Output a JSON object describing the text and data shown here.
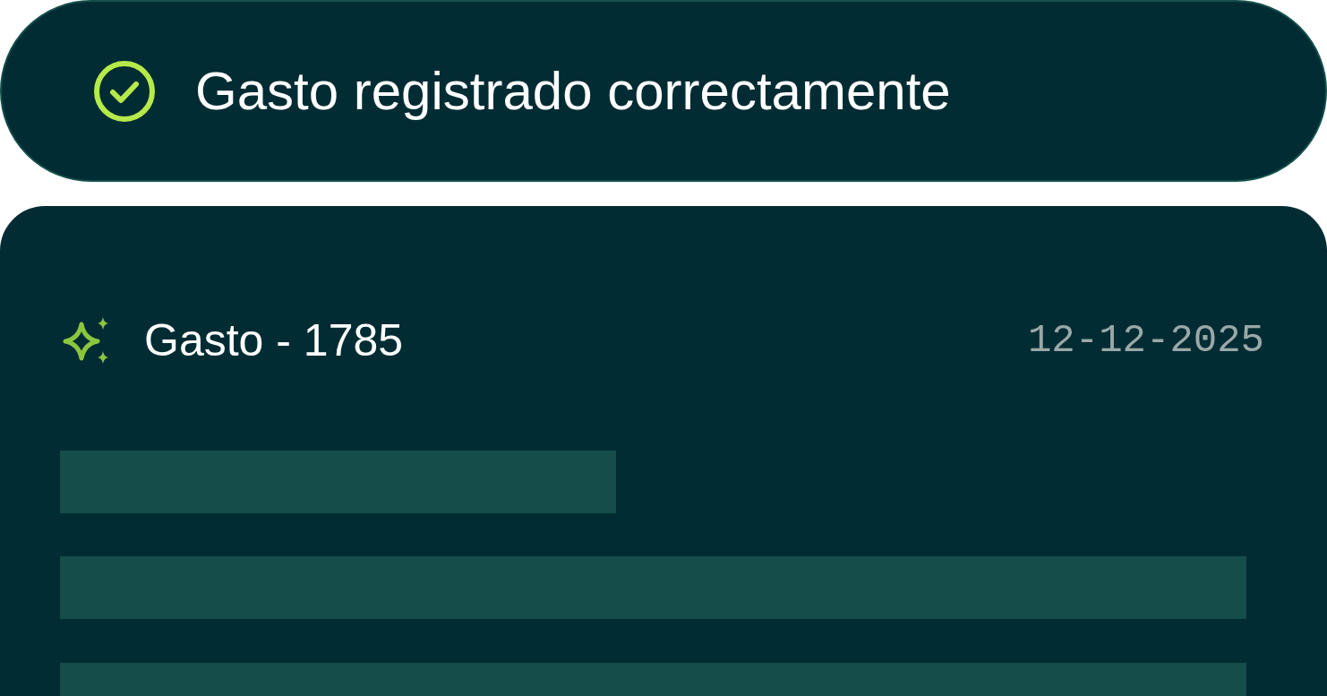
{
  "toast": {
    "message": "Gasto registrado correctamente"
  },
  "card": {
    "title": "Gasto - 1785",
    "date": "12-12-2025"
  }
}
